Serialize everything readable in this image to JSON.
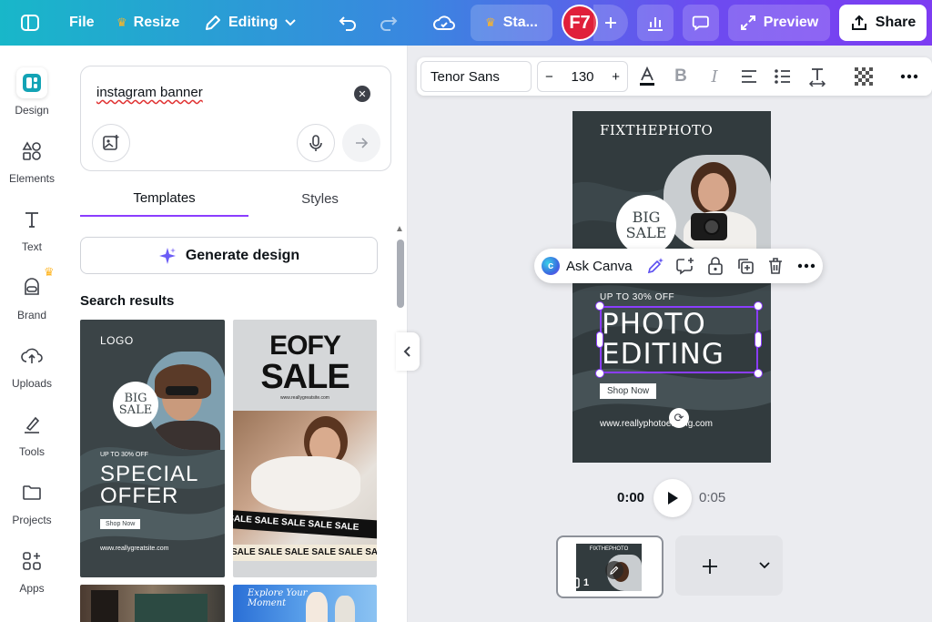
{
  "topbar": {
    "file_label": "File",
    "resize_label": "Resize",
    "editing_label": "Editing",
    "team_label": "Sta...",
    "avatar_initials": "F7",
    "preview_label": "Preview",
    "share_label": "Share"
  },
  "rail": {
    "items": [
      {
        "label": "Design"
      },
      {
        "label": "Elements"
      },
      {
        "label": "Text"
      },
      {
        "label": "Brand"
      },
      {
        "label": "Uploads"
      },
      {
        "label": "Tools"
      },
      {
        "label": "Projects"
      },
      {
        "label": "Apps"
      }
    ]
  },
  "panel": {
    "search_value": "instagram banner",
    "tabs": [
      {
        "label": "Templates"
      },
      {
        "label": "Styles"
      }
    ],
    "generate_label": "Generate design",
    "results_title": "Search results",
    "templates": [
      {
        "logo": "LOGO",
        "badge_line1": "BIG",
        "badge_line2": "SALE",
        "offer": "UP TO 30% OFF",
        "headline_line1": "SPECIAL",
        "headline_line2": "OFFER",
        "button": "Shop Now",
        "url": "www.reallygreatsite.com"
      },
      {
        "headline_line1": "EOFY",
        "headline_line2": "SALE",
        "url": "www.reallygreatsite.com",
        "ribbon1": "SALE SALE SALE SALE SALE",
        "ribbon2": "SALE SALE SALE SALE SALE SALE"
      },
      {},
      {
        "headline_line1": "Explore Your",
        "headline_line2": "Moment"
      }
    ]
  },
  "text_toolbar": {
    "font": "Tenor Sans",
    "size": "130"
  },
  "context_menu": {
    "ask_label": "Ask Canva"
  },
  "design": {
    "brand": "FIXTHEPHOTO",
    "badge_line1": "BIG",
    "badge_line2": "SALE",
    "offer": "UP TO 30% OFF",
    "headline_line1": "PHOTO",
    "headline_line2": "EDITING",
    "button": "Shop Now",
    "url": "www.reallyphotoediting.com"
  },
  "playback": {
    "current_time": "0:00",
    "duration": "0:05",
    "page_number": "1"
  },
  "colors": {
    "accent": "#8b3dff",
    "template_dark": "#323b3e",
    "avatar": "#e0203a"
  }
}
